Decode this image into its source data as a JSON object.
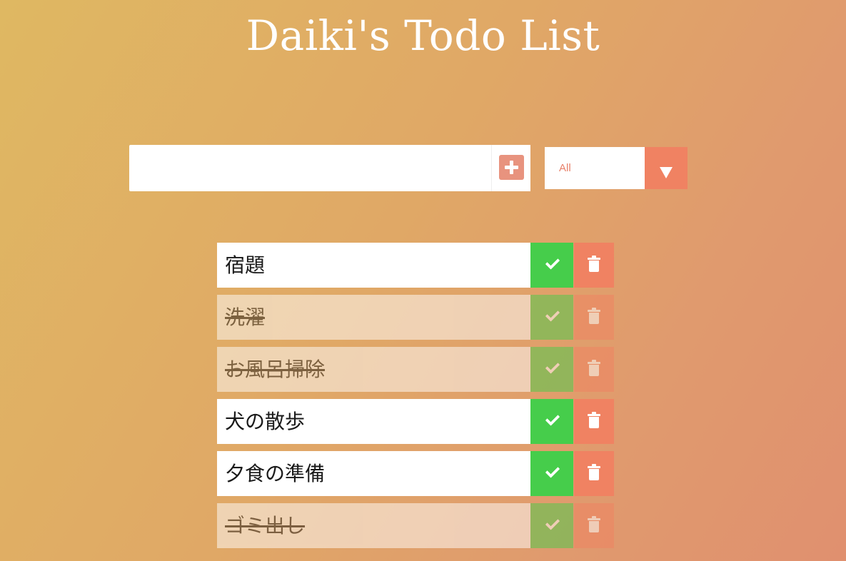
{
  "header": {
    "title": "Daiki's Todo List"
  },
  "form": {
    "input_value": "",
    "add_icon": "plus-square-icon",
    "filter": {
      "selected": "All",
      "icon": "caret-down-icon"
    }
  },
  "todos": [
    {
      "text": "宿題",
      "completed": false
    },
    {
      "text": "洗濯",
      "completed": true
    },
    {
      "text": "お風呂掃除",
      "completed": true
    },
    {
      "text": "犬の散歩",
      "completed": false
    },
    {
      "text": "夕食の準備",
      "completed": false
    },
    {
      "text": "ゴミ出し",
      "completed": true
    }
  ],
  "icons": {
    "complete": "check-icon",
    "delete": "trash-icon"
  },
  "colors": {
    "accent": "#f08262",
    "complete": "#46cd4b",
    "add_icon": "#e8937e"
  }
}
